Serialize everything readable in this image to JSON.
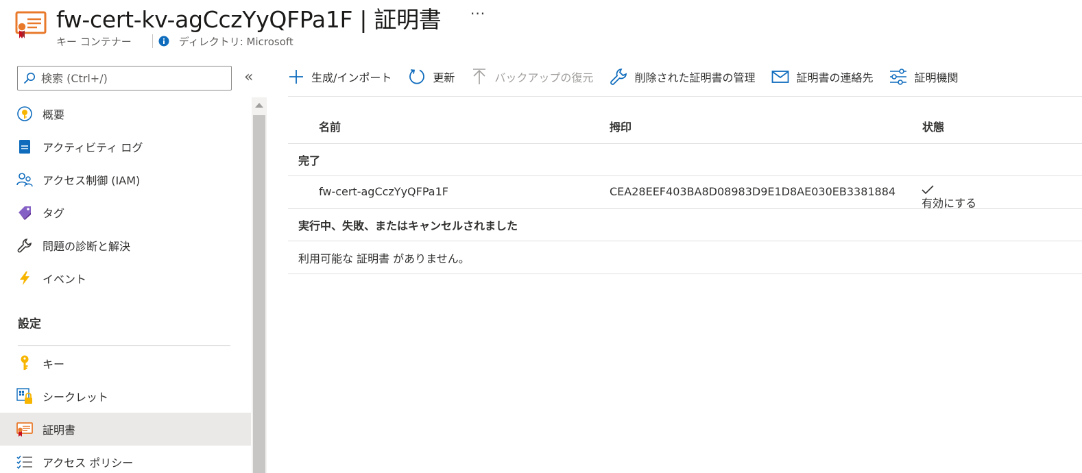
{
  "header": {
    "title": "fw-cert-kv-agCczYyQFPa1F | 証明書",
    "more": "···",
    "resource_type": "キー コンテナー",
    "directory": "ディレクトリ: Microsoft",
    "icon": "certificate-icon"
  },
  "sidebar": {
    "search_placeholder": "検索 (Ctrl+/)",
    "collapse": "«",
    "items": [
      {
        "label": "概要",
        "icon": "overview-icon"
      },
      {
        "label": "アクティビティ ログ",
        "icon": "activity-log-icon"
      },
      {
        "label": "アクセス制御 (IAM)",
        "icon": "access-control-icon"
      },
      {
        "label": "タグ",
        "icon": "tag-icon"
      },
      {
        "label": "問題の診断と解決",
        "icon": "wrench-icon"
      },
      {
        "label": "イベント",
        "icon": "lightning-icon"
      }
    ],
    "section_label": "設定",
    "settings_items": [
      {
        "label": "キー",
        "icon": "key-icon"
      },
      {
        "label": "シークレット",
        "icon": "secret-icon"
      },
      {
        "label": "証明書",
        "icon": "certificate-icon",
        "selected": true
      },
      {
        "label": "アクセス ポリシー",
        "icon": "access-policy-icon"
      }
    ]
  },
  "toolbar": {
    "generate_import": "生成/インポート",
    "refresh": "更新",
    "restore_backup": "バックアップの復元",
    "manage_deleted": "削除された証明書の管理",
    "contacts": "証明書の連絡先",
    "authorities": "証明機関"
  },
  "table": {
    "columns": [
      "名前",
      "拇印",
      "状態"
    ],
    "groups": [
      {
        "label": "完了",
        "rows": [
          {
            "name": "fw-cert-agCczYyQFPa1F",
            "thumbprint": "CEA28EEF403BA8D08983D9E1D8AE030EB3381884",
            "status": "有効にする"
          }
        ]
      },
      {
        "label": "実行中、失敗、またはキャンセルされました",
        "empty_message": "利用可能な 証明書 がありません。"
      }
    ]
  },
  "colors": {
    "accent": "#0078d4",
    "selected_bg": "#ebe9e7",
    "cert_orange": "#e8792b",
    "key_yellow": "#f7b500"
  }
}
